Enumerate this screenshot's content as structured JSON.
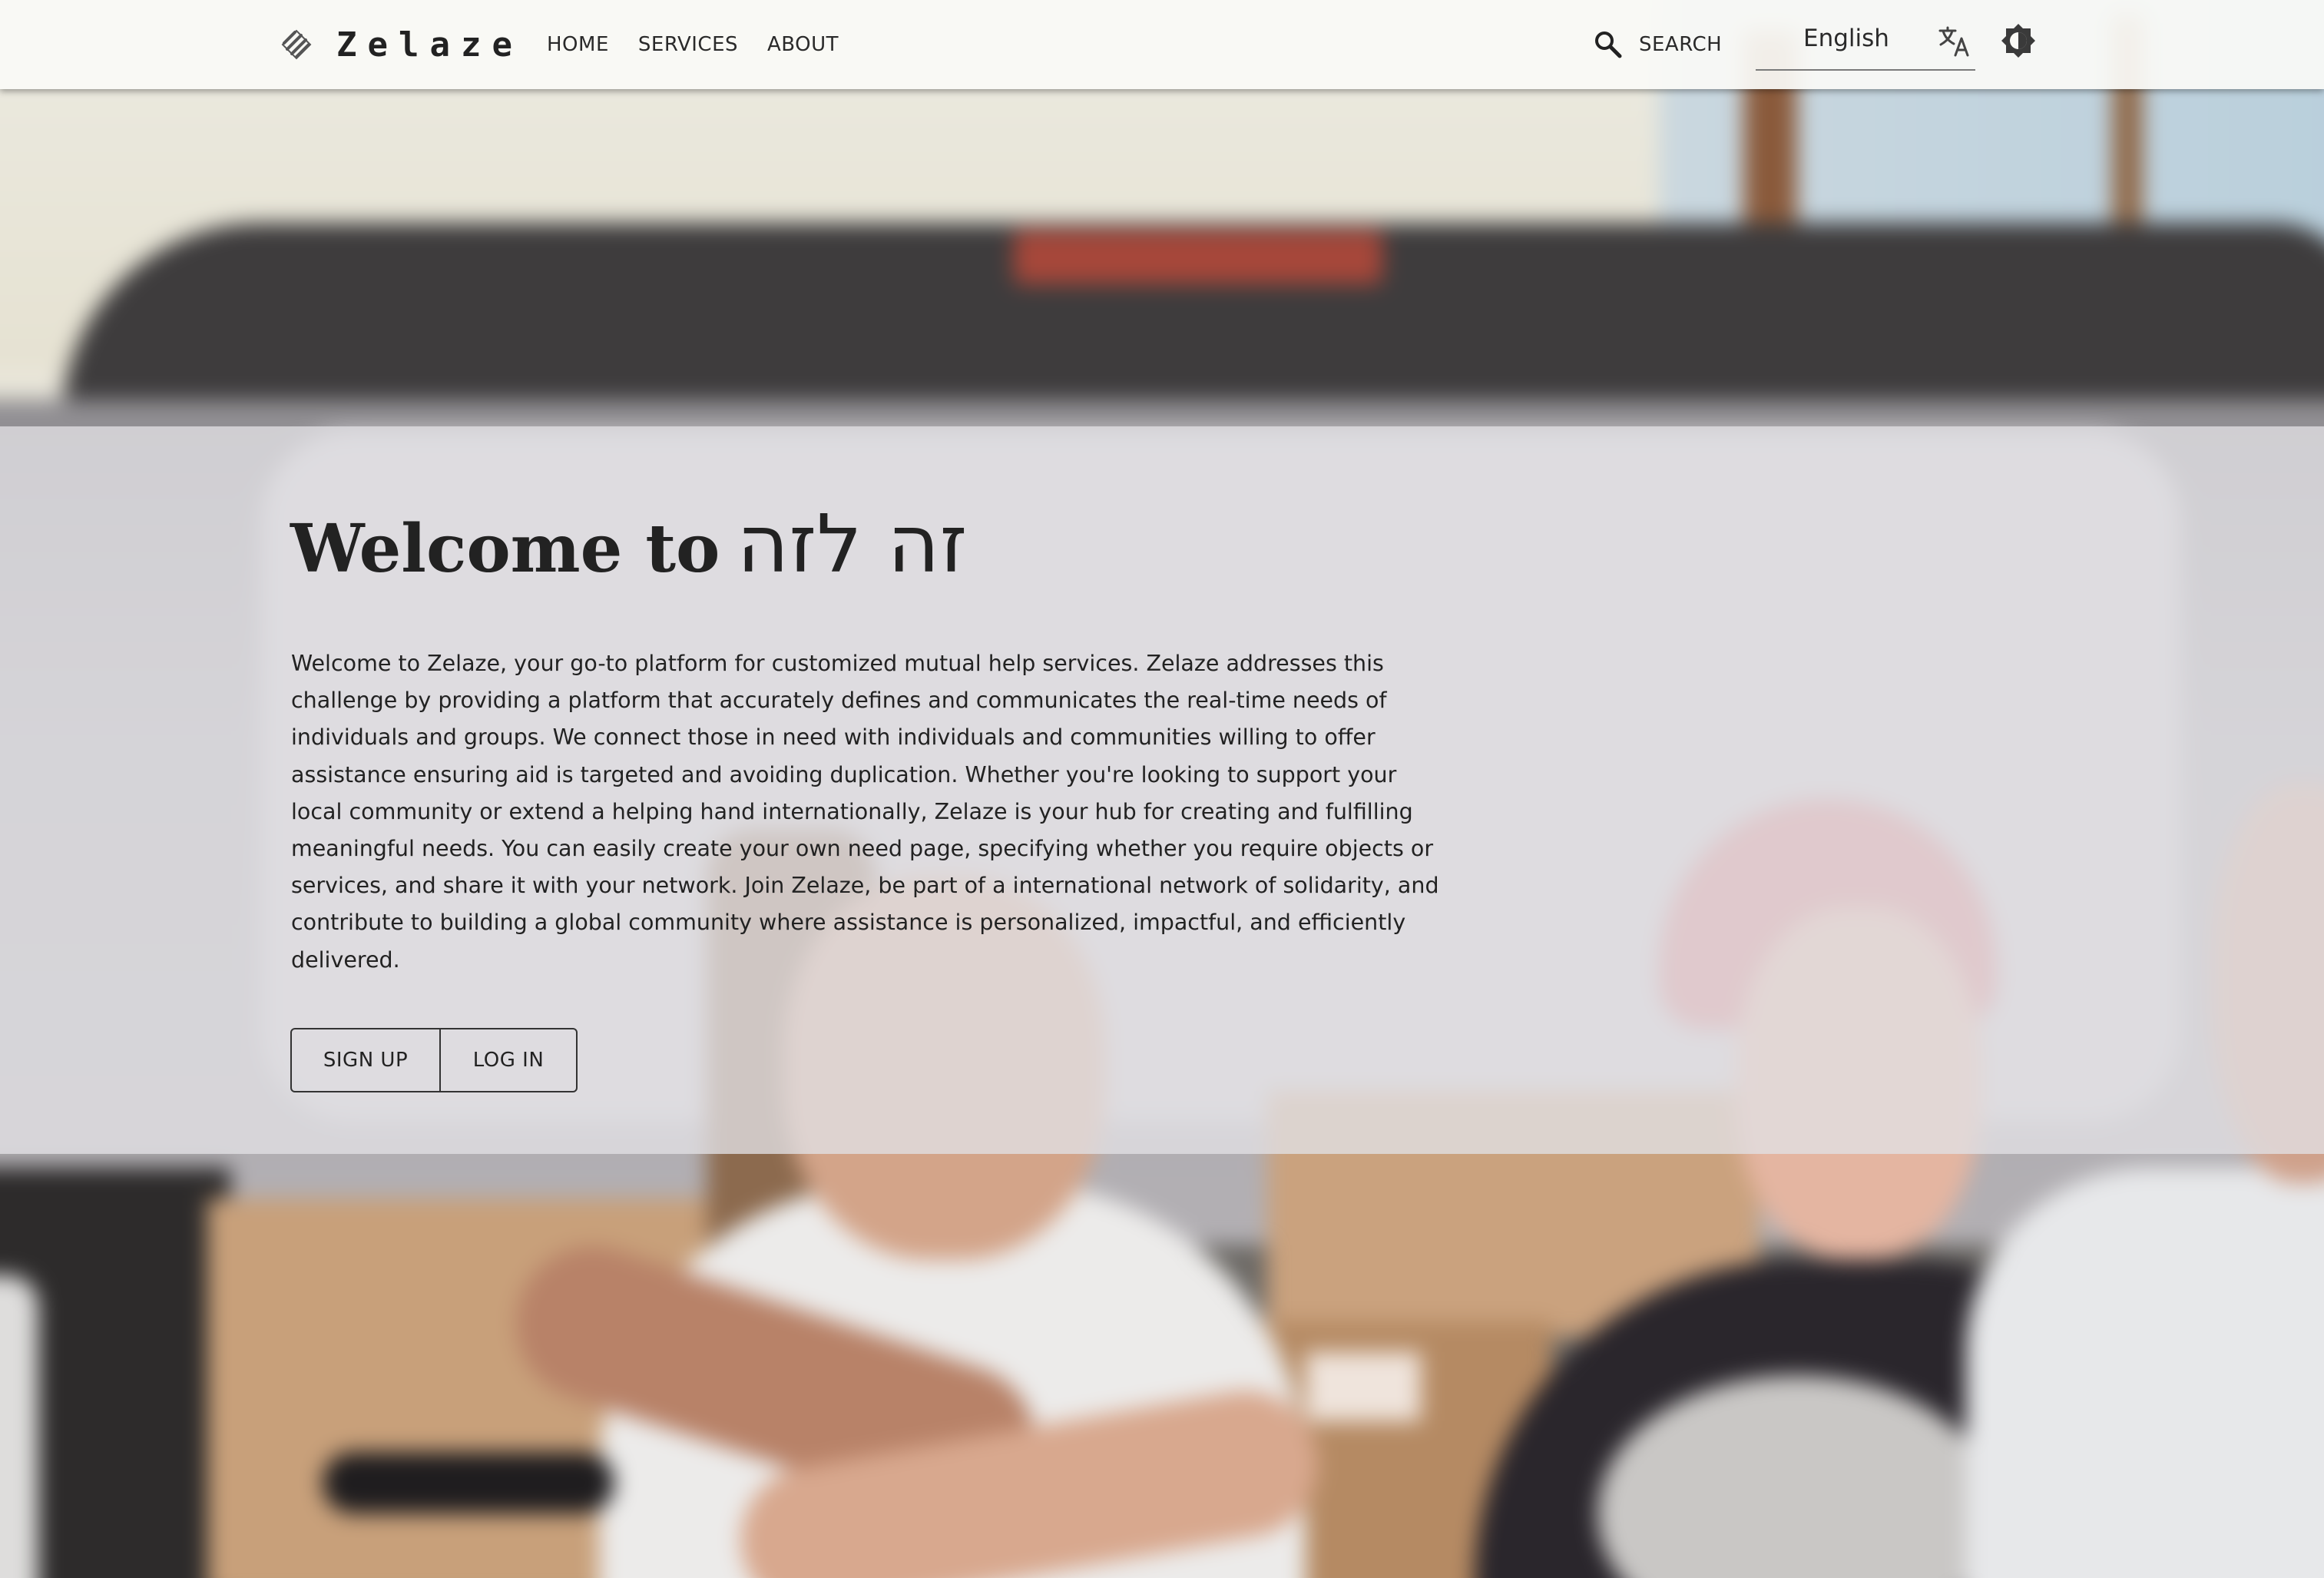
{
  "header": {
    "brand_name": "Zelaze",
    "nav": [
      {
        "label": "HOME"
      },
      {
        "label": "SERVICES"
      },
      {
        "label": "ABOUT"
      }
    ],
    "search_label": "SEARCH",
    "language_value": "English",
    "icons": {
      "logo": "zelaze-logo-icon",
      "search": "search-icon",
      "language": "translate-icon",
      "theme": "theme-toggle-icon"
    }
  },
  "hero": {
    "title_lead": "Welcome to",
    "title_hebrew": "זה לזה",
    "description": "Welcome to Zelaze, your go-to platform for customized mutual help services. Zelaze addresses this challenge by providing a platform that accurately defines and communicates the real-time needs of individuals and groups. We connect those in need with individuals and communities willing to offer assistance ensuring aid is targeted and avoiding duplication. Whether you're looking to support your local community or extend a helping hand internationally, Zelaze is your hub for creating and fulfilling meaningful needs. You can easily create your own need page, specifying whether you require objects or services, and share it with your network. Join Zelaze, be part of a international network of solidarity, and contribute to building a global community where assistance is personalized, impactful, and efficiently delivered.",
    "signup_label": "SIGN UP",
    "login_label": "LOG IN"
  },
  "colors": {
    "header_bg": "#fafaf6",
    "text": "#222222",
    "hero_overlay": "#e2e0e4"
  }
}
